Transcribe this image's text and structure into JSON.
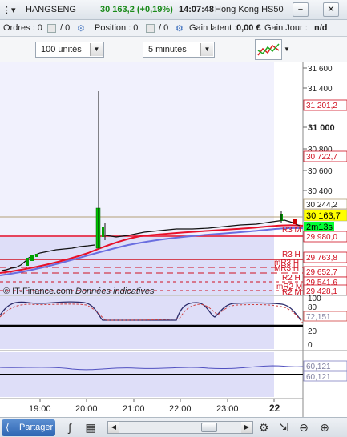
{
  "titlebar": {
    "instrument": "HANGSENG",
    "price": "30 163,2 (+0,19%)",
    "time": "14:07:48",
    "market": "Hong Kong HS50",
    "minimize": "−",
    "close": "✕"
  },
  "orders": {
    "orders_label": "Ordres : 0",
    "orders_count": "/ 0",
    "position_label": "Position : 0",
    "position_count": "/ 0",
    "latent_label": "Gain latent :",
    "latent_value": "0,00 €",
    "day_label": "Gain Jour :",
    "day_value": "n/d"
  },
  "toolbar": {
    "units_value": "100 unités",
    "interval_value": "5 minutes"
  },
  "price_panel": {
    "y_ticks": [
      "31 600",
      "31 400",
      "31 201,2",
      "31 000",
      "30 800",
      "30 722,7",
      "30 600",
      "30 400",
      "30 244,2",
      "30 163,7",
      "2m13s",
      "29 980,0",
      "29 763,8",
      "29 652,7",
      "29 541,6",
      "29 428,1"
    ],
    "level_labels": [
      "R3 M",
      "R3 H",
      "mR3 H",
      "MR3 H",
      "R2 H",
      "mR2 M",
      "R2 M"
    ],
    "watermark": "© IT-Finance.com",
    "watermark_note": "Données indicatives"
  },
  "osc1": {
    "y_ticks": [
      "100",
      "80",
      "72,151",
      "20",
      "0"
    ]
  },
  "osc2": {
    "y_ticks": [
      "60,121",
      "60,121"
    ]
  },
  "x_axis": [
    "19:00",
    "20:00",
    "21:00",
    "22:00",
    "23:00",
    "22"
  ],
  "bottombar": {
    "share_label": "Partager"
  },
  "colors": {
    "price_up": "#00a000",
    "red_line": "#e8102a",
    "blue_line": "#6a6ee0",
    "current_price_bg": "#ffff00",
    "timer_bg": "#00ff33",
    "panel_bg": "#e4e4fa"
  }
}
